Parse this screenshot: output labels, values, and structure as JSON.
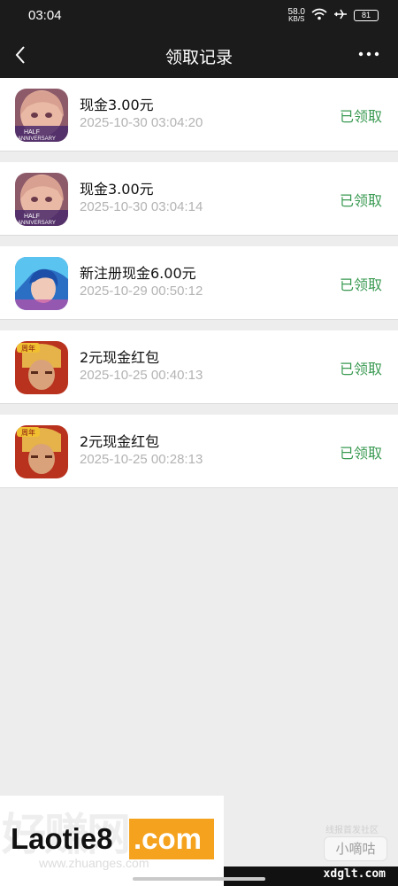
{
  "status_bar": {
    "time": "03:04",
    "net_speed": "58.0",
    "net_unit": "KB/S",
    "battery": "81"
  },
  "nav": {
    "title": "领取记录"
  },
  "records": [
    {
      "title": "现金3.00元",
      "time": "2025-10-30 03:04:20",
      "status": "已领取",
      "icon": "anime-girl-half-anniversary-icon"
    },
    {
      "title": "现金3.00元",
      "time": "2025-10-30 03:04:14",
      "status": "已领取",
      "icon": "anime-girl-half-anniversary-icon"
    },
    {
      "title": "新注册现金6.00元",
      "time": "2025-10-29 00:50:12",
      "status": "已领取",
      "icon": "blue-hair-hero-icon"
    },
    {
      "title": "2元现金红包",
      "time": "2025-10-25 00:40:13",
      "status": "已领取",
      "icon": "golden-warrior-anniversary-icon"
    },
    {
      "title": "2元现金红包",
      "time": "2025-10-25 00:28:13",
      "status": "已领取",
      "icon": "golden-warrior-anniversary-icon"
    }
  ],
  "icon_text": {
    "half_anniversary_1": "HALF",
    "half_anniversary_2": "ANNIVERSARY",
    "years_badge": "周年"
  },
  "watermark": {
    "logo_main": "Laotie8",
    "logo_domain": ".com",
    "ghost_text": "好赚网",
    "ghost_url": "www.zhuanges.com",
    "right_tag": "线报首发社区",
    "right_badge": "小嘀咕",
    "bottom_domain": "xdglt.com"
  },
  "colors": {
    "claimed_green": "#3a9a52",
    "topbar": "#1b1b1b",
    "page_bg": "#ededed",
    "logo_orange": "#f5a31e"
  }
}
